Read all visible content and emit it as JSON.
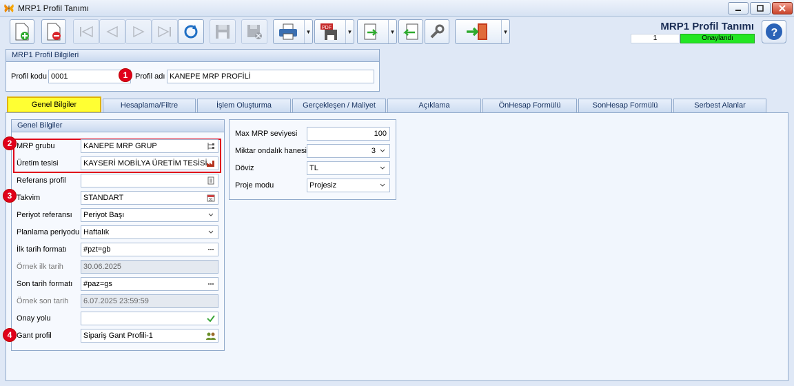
{
  "window": {
    "title": "MRP1 Profil Tanımı"
  },
  "header": {
    "title": "MRP1 Profil Tanımı",
    "status_number": "1",
    "status_label": "Onaylandı",
    "status_color": "#23e623"
  },
  "profile_group": {
    "title": "MRP1 Profil Bilgileri",
    "code_label": "Profil kodu",
    "code_value": "0001",
    "name_label": "Profil adı",
    "name_value": "KANEPE MRP PROFİLİ"
  },
  "badges": [
    "1",
    "2",
    "3",
    "4"
  ],
  "tabs": [
    "Genel Bilgiler",
    "Hesaplama/Filtre",
    "İşlem Oluşturma",
    "Gerçekleşen / Maliyet",
    "Açıklama",
    "ÖnHesap Formülü",
    "SonHesap Formülü",
    "Serbest Alanlar"
  ],
  "general": {
    "title": "Genel Bilgiler",
    "fields": [
      {
        "label": "MRP grubu",
        "value": "KANEPE MRP GRUP",
        "icon": "tree-icon"
      },
      {
        "label": "Üretim tesisi",
        "value": "KAYSERİ MOBİLYA ÜRETİM TESİSİ",
        "icon": "factory-icon"
      },
      {
        "label": "Referans profil",
        "value": "",
        "icon": "list-icon"
      },
      {
        "label": "Takvim",
        "value": "STANDART",
        "icon": "calendar-icon"
      },
      {
        "label": "Periyot referansı",
        "value": "Periyot Başı",
        "icon": "chevron-down-icon"
      },
      {
        "label": "Planlama periyodu",
        "value": "Haftalık",
        "icon": "chevron-down-icon"
      },
      {
        "label": "İlk tarih formatı",
        "value": "#pzt=gb",
        "icon": "ellipsis-icon"
      },
      {
        "label": "Örnek ilk tarih",
        "value": "30.06.2025",
        "icon": ""
      },
      {
        "label": "Son tarih formatı",
        "value": "#paz=gs",
        "icon": "ellipsis-icon"
      },
      {
        "label": "Örnek son tarih",
        "value": "6.07.2025 23:59:59",
        "icon": ""
      },
      {
        "label": "Onay yolu",
        "value": "",
        "icon": "check-icon"
      },
      {
        "label": "Gant profil",
        "value": "Sipariş Gant Profili-1",
        "icon": "people-icon"
      }
    ]
  },
  "mrp": {
    "fields": [
      {
        "label": "Max MRP seviyesi",
        "value": "100"
      },
      {
        "label": "Miktar ondalık hanesi",
        "value": "3"
      },
      {
        "label": "Döviz",
        "value": "TL"
      },
      {
        "label": "Proje modu",
        "value": "Projesiz"
      }
    ]
  }
}
